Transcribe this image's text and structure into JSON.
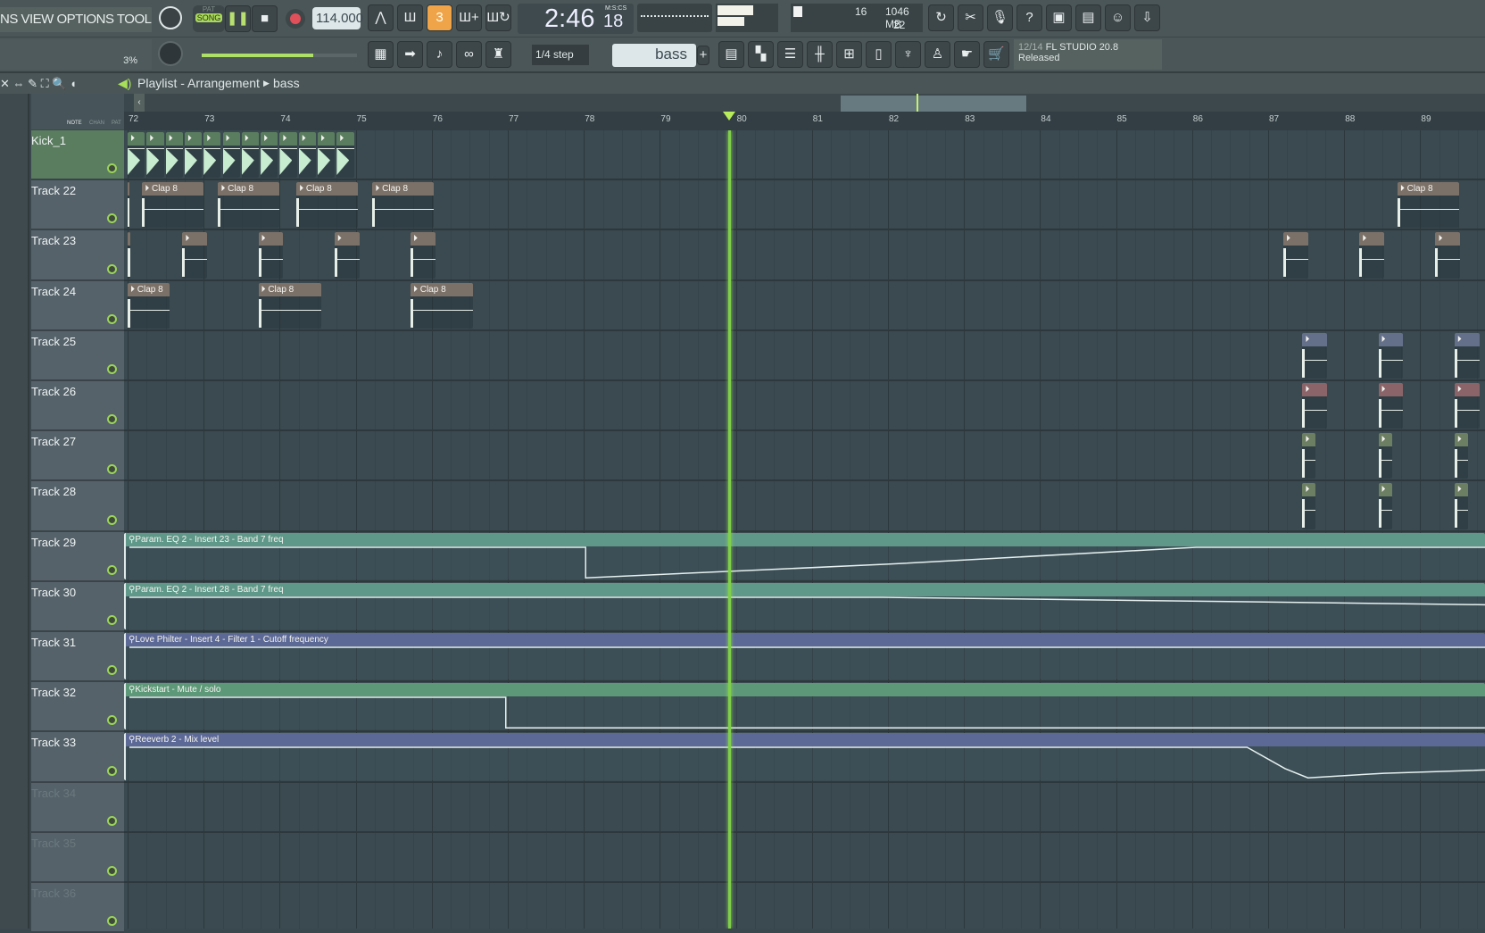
{
  "menu": {
    "items": "NS VIEW OPTIONS TOOLS HELP"
  },
  "transport": {
    "pat_label": "PAT",
    "song_label": "SONG",
    "tempo": "114.000",
    "time": "2:46",
    "time_cs": "18",
    "time_format": "M:S:CS",
    "master_pct": "3%",
    "master_volume": 0.72
  },
  "monitor": {
    "voices": "16",
    "memory": "1046 MB",
    "cpu": "22"
  },
  "snap": {
    "label": "1/4 step"
  },
  "pattern": {
    "name": "bass"
  },
  "news": {
    "count": "12/14",
    "title": "FL STUDIO 20.8",
    "status": "Released"
  },
  "playlist": {
    "title": "Playlist - Arrangement",
    "breadcrumb": "bass",
    "tabs": [
      "NOTE",
      "CHAN",
      "PAT"
    ]
  },
  "ruler": {
    "bars": [
      72,
      73,
      74,
      75,
      76,
      77,
      78,
      79,
      80,
      81,
      82,
      83,
      84,
      85,
      86,
      87,
      88,
      89
    ],
    "playhead_bar": 79.9
  },
  "colors": {
    "kick": "#5b7d5f",
    "clap": "#7c7168",
    "eq": "#5f9888",
    "love": "#5c6895",
    "kickstart": "#5d9878",
    "reeverb": "#5c6895",
    "blueclip": "#646f8a",
    "redclip": "#8a6468",
    "greenclip": "#6c7f62",
    "accent": "#9bd35a"
  },
  "tracks": [
    {
      "name": "Kick_1",
      "clips": [
        {
          "start": 72,
          "len": 0.25,
          "label": ""
        },
        {
          "start": 72.25,
          "len": 0.25,
          "label": ""
        },
        {
          "start": 72.5,
          "len": 0.25,
          "label": ""
        },
        {
          "start": 72.75,
          "len": 0.25,
          "label": ""
        },
        {
          "start": 73,
          "len": 0.25,
          "label": ""
        },
        {
          "start": 73.25,
          "len": 0.25,
          "label": ""
        },
        {
          "start": 73.5,
          "len": 0.25,
          "label": ""
        },
        {
          "start": 73.75,
          "len": 0.25,
          "label": ""
        },
        {
          "start": 74,
          "len": 0.25,
          "label": ""
        },
        {
          "start": 74.25,
          "len": 0.25,
          "label": ""
        },
        {
          "start": 74.5,
          "len": 0.25,
          "label": ""
        },
        {
          "start": 74.75,
          "len": 0.25,
          "label": ""
        }
      ],
      "color": "kick"
    },
    {
      "name": "Track 22",
      "clips": [
        {
          "start": 72,
          "len": 0.05,
          "label": ""
        },
        {
          "start": 72.19,
          "len": 0.83,
          "label": "Clap 8"
        },
        {
          "start": 73.19,
          "len": 0.83,
          "label": "Clap 8"
        },
        {
          "start": 74.22,
          "len": 0.83,
          "label": "Clap 8"
        },
        {
          "start": 75.22,
          "len": 0.83,
          "label": "Clap 8"
        },
        {
          "start": 88.7,
          "len": 0.83,
          "label": "Clap 8"
        }
      ],
      "color": "clap"
    },
    {
      "name": "Track 23",
      "clips": [
        {
          "start": 72,
          "len": 0.06,
          "label": ""
        },
        {
          "start": 72.72,
          "len": 0.35,
          "label": ""
        },
        {
          "start": 73.72,
          "len": 0.35,
          "label": ""
        },
        {
          "start": 74.72,
          "len": 0.35,
          "label": ""
        },
        {
          "start": 75.72,
          "len": 0.35,
          "label": ""
        },
        {
          "start": 87.2,
          "len": 0.35,
          "label": ""
        },
        {
          "start": 88.2,
          "len": 0.35,
          "label": ""
        },
        {
          "start": 89.2,
          "len": 0.35,
          "label": ""
        }
      ],
      "color": "clap"
    },
    {
      "name": "Track 24",
      "clips": [
        {
          "start": 72,
          "len": 0.57,
          "label": "Clap 8"
        },
        {
          "start": 73.72,
          "len": 0.85,
          "label": "Clap 8"
        },
        {
          "start": 75.72,
          "len": 0.85,
          "label": "Clap 8"
        }
      ],
      "color": "clap"
    },
    {
      "name": "Track 25",
      "clips": [
        {
          "start": 87.45,
          "len": 0.35,
          "label": ""
        },
        {
          "start": 88.45,
          "len": 0.35,
          "label": ""
        },
        {
          "start": 89.45,
          "len": 0.35,
          "label": ""
        }
      ],
      "color": "blueclip"
    },
    {
      "name": "Track 26",
      "clips": [
        {
          "start": 87.45,
          "len": 0.35,
          "label": ""
        },
        {
          "start": 88.45,
          "len": 0.35,
          "label": ""
        },
        {
          "start": 89.45,
          "len": 0.35,
          "label": ""
        }
      ],
      "color": "redclip"
    },
    {
      "name": "Track 27",
      "clips": [
        {
          "start": 87.45,
          "len": 0.2,
          "label": ""
        },
        {
          "start": 88.45,
          "len": 0.2,
          "label": ""
        },
        {
          "start": 89.45,
          "len": 0.2,
          "label": ""
        }
      ],
      "color": "greenclip"
    },
    {
      "name": "Track 28",
      "clips": [
        {
          "start": 87.45,
          "len": 0.2,
          "label": ""
        },
        {
          "start": 88.45,
          "len": 0.2,
          "label": ""
        },
        {
          "start": 89.45,
          "len": 0.2,
          "label": ""
        }
      ],
      "color": "greenclip"
    },
    {
      "name": "Track 29",
      "auto": {
        "label": "Param. EQ 2 - Insert 23 - Band 7 freq",
        "points": [
          [
            72,
            1
          ],
          [
            78,
            1
          ],
          [
            78,
            0
          ],
          [
            82,
            0.45
          ],
          [
            86.03,
            1
          ],
          [
            91,
            1
          ]
        ]
      },
      "color": "eq"
    },
    {
      "name": "Track 30",
      "auto": {
        "label": "Param. EQ 2 - Insert 28 - Band 7 freq",
        "points": [
          [
            72,
            1
          ],
          [
            81.9,
            1
          ],
          [
            91,
            0.72
          ]
        ]
      },
      "color": "eq"
    },
    {
      "name": "Track 31",
      "auto": {
        "label": "Love Philter - Insert 4 - Filter 1 - Cutoff frequency",
        "points": [
          [
            72,
            1
          ],
          [
            91,
            1
          ]
        ]
      },
      "color": "love"
    },
    {
      "name": "Track 32",
      "auto": {
        "label": "Kickstart - Mute / solo",
        "points": [
          [
            72,
            1
          ],
          [
            76.95,
            1
          ],
          [
            76.95,
            0
          ],
          [
            91,
            0
          ]
        ]
      },
      "color": "kickstart"
    },
    {
      "name": "Track 33",
      "auto": {
        "label": "Reeverb 2 - Mix level",
        "points": [
          [
            72,
            1
          ],
          [
            86.7,
            1
          ],
          [
            87.2,
            0.3
          ],
          [
            87.5,
            0
          ],
          [
            88.5,
            0.15
          ],
          [
            91,
            0.35
          ]
        ]
      },
      "color": "reeverb"
    },
    {
      "name": "Track 34",
      "dim": true
    },
    {
      "name": "Track 35",
      "dim": true
    },
    {
      "name": "Track 36",
      "dim": true
    }
  ]
}
